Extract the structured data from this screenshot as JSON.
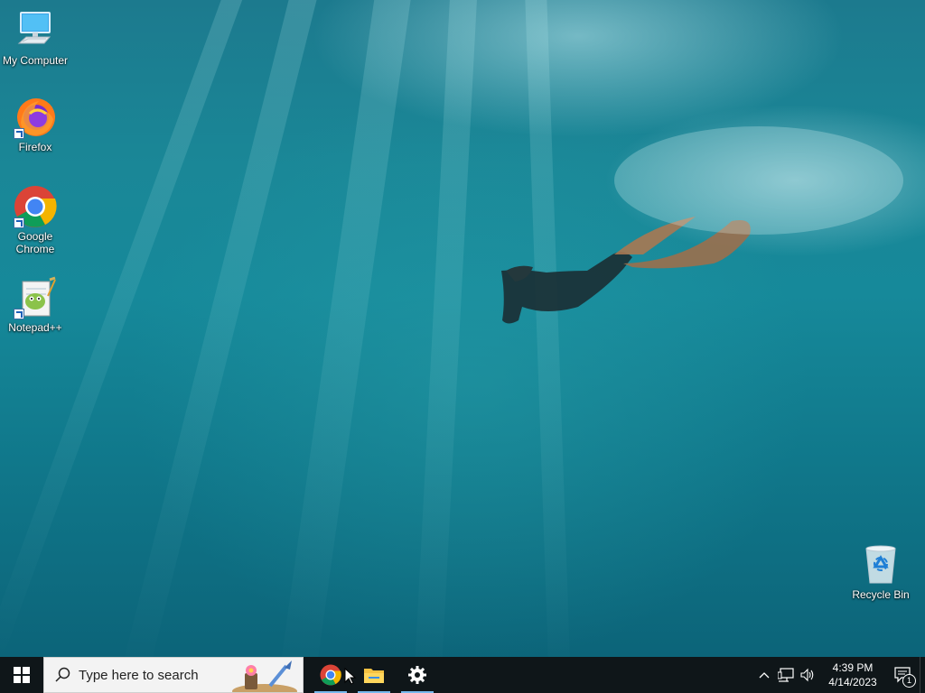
{
  "desktop": {
    "icons": [
      {
        "label": "My Computer",
        "icon": "computer-icon"
      },
      {
        "label": "Firefox",
        "icon": "firefox-icon"
      },
      {
        "label": "Google Chrome",
        "icon": "chrome-icon"
      },
      {
        "label": "Notepad++",
        "icon": "notepad-plus-plus-icon"
      },
      {
        "label": "Recycle Bin",
        "icon": "recycle-bin-icon"
      }
    ]
  },
  "taskbar": {
    "search_placeholder": "Type here to search",
    "pinned": [
      {
        "name": "Google Chrome",
        "icon": "chrome-icon",
        "running": true
      },
      {
        "name": "File Explorer",
        "icon": "folder-icon",
        "running": true
      },
      {
        "name": "Settings",
        "icon": "gear-icon",
        "running": true
      }
    ],
    "clock": {
      "time": "4:39 PM",
      "date": "4/14/2023"
    },
    "notification_count": "1"
  },
  "colors": {
    "taskbar_bg": "#0f1619",
    "running_indicator": "#76b9ed",
    "water_top": "#1c7a8e",
    "water_bottom": "#0c6479"
  }
}
